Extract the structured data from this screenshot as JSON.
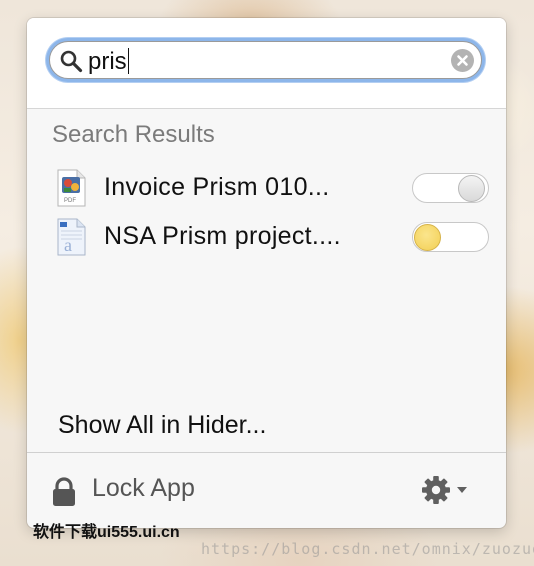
{
  "search": {
    "query": "pris"
  },
  "results": {
    "header": "Search Results",
    "items": [
      {
        "name": "Invoice Prism 010...",
        "file_type": "pdf",
        "hidden": false
      },
      {
        "name": "NSA Prism project....",
        "file_type": "text",
        "hidden": true
      }
    ]
  },
  "show_all_label": "Show All in Hider...",
  "footer": {
    "lock_label": "Lock App",
    "settings_icon": "gear-icon"
  },
  "colors": {
    "focus_ring": "#8db6ea",
    "toggle_on": "#f2cf53",
    "toggle_off": "#e0e0e0"
  },
  "watermark": {
    "left": "软件下载ui555.ui.cn",
    "right": "https://blog.csdn.net/omnix/zuozuo"
  }
}
